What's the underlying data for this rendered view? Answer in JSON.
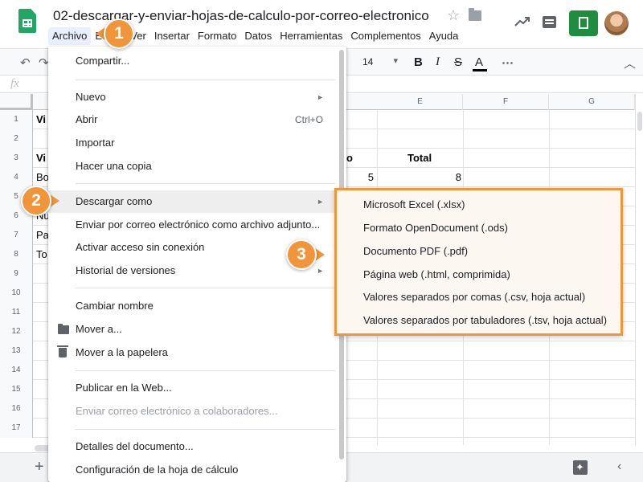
{
  "app": {
    "doc_title": "02-descargar-y-enviar-hojas-de-calculo-por-correo-electronico",
    "menubar": [
      "Archivo",
      "Editar",
      "Ver",
      "Insertar",
      "Formato",
      "Datos",
      "Herramientas",
      "Complementos",
      "Ayuda"
    ],
    "accent_color": "#f0953a",
    "icons": [
      "sheets-logo",
      "star-icon",
      "folder-icon",
      "trend-icon",
      "comment-icon",
      "share-button",
      "avatar"
    ]
  },
  "toolbar": {
    "undo": "↶",
    "redo": "↷",
    "font_size": "14",
    "bold": "B",
    "italic": "I",
    "strike": "S",
    "text_color": "A",
    "more": "⋯",
    "collapse": "︿"
  },
  "formula_bar": {
    "fx": "fx"
  },
  "grid": {
    "columns": [
      "E",
      "F",
      "G"
    ],
    "rows": [
      "1",
      "2",
      "3",
      "4",
      "5",
      "6",
      "7",
      "8",
      "9",
      "10",
      "11",
      "12",
      "13",
      "14",
      "15",
      "16",
      "17"
    ],
    "cells": {
      "a1": "Vi",
      "a3": "Vi",
      "a4": "Bo",
      "a6": "Nu",
      "a7": "Pa",
      "a8": "To",
      "d3": "o",
      "d4": "5",
      "e3": "Total",
      "e4": "8"
    }
  },
  "file_menu": {
    "share": "Compartir...",
    "new": "Nuevo",
    "open": "Abrir",
    "open_shortcut": "Ctrl+O",
    "import": "Importar",
    "copy": "Hacer una copia",
    "download_as": "Descargar como",
    "email_attachment": "Enviar por correo electrónico como archivo adjunto...",
    "offline": "Activar acceso sin conexión",
    "version_history": "Historial de versiones",
    "rename": "Cambiar nombre",
    "move_to": "Mover a...",
    "trash": "Mover a la papelera",
    "publish": "Publicar en la Web...",
    "email_collaborators": "Enviar correo electrónico a colaboradores...",
    "details": "Detalles del documento...",
    "settings": "Configuración de la hoja de cálculo",
    "arrow": "►"
  },
  "download_submenu": [
    "Microsoft Excel (.xlsx)",
    "Formato OpenDocument (.ods)",
    "Documento PDF (.pdf)",
    "Página web (.html, comprimida)",
    "Valores separados por comas (.csv, hoja actual)",
    "Valores separados por tabuladores (.tsv, hoja actual)"
  ],
  "callouts": [
    "1",
    "2",
    "3"
  ],
  "bottom_bar": {
    "add_sheet": "+",
    "collapse": "‹"
  }
}
